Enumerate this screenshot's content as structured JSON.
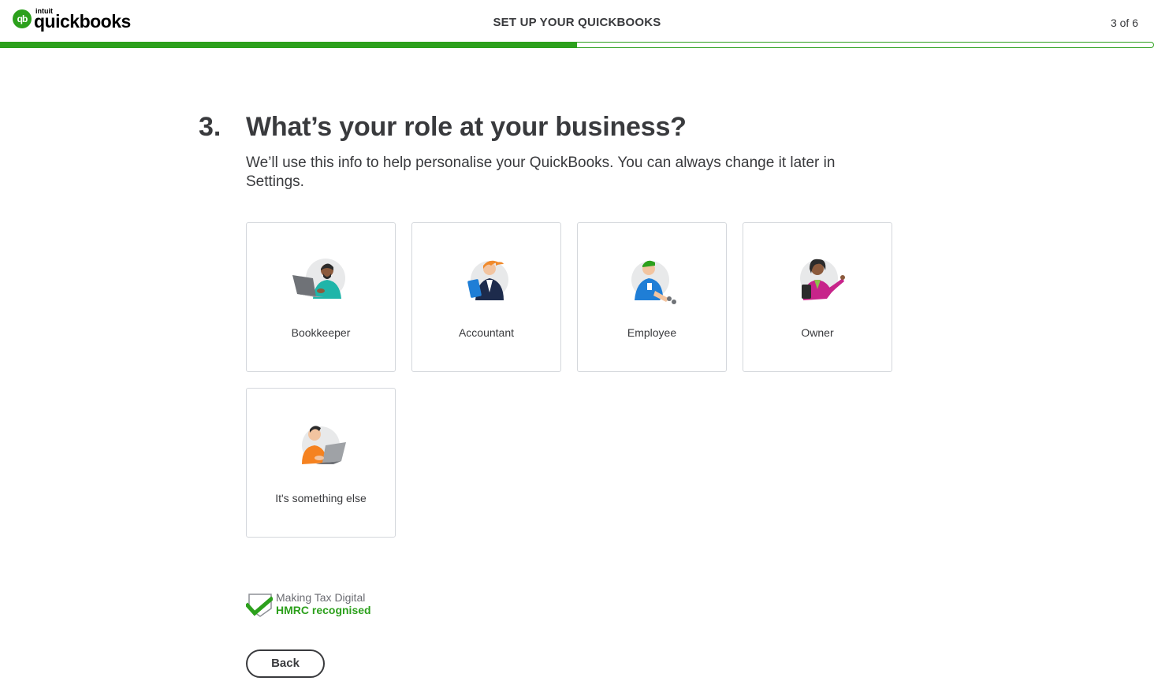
{
  "header": {
    "logo_brand_small": "intuit",
    "logo_brand": "quickbooks",
    "title": "SET UP YOUR QUICKBOOKS",
    "step_counter": "3 of 6"
  },
  "progress": {
    "fraction": 0.5
  },
  "question": {
    "number": "3.",
    "title": "What’s your role at your business?",
    "subtitle": "We’ll use this info to help personalise your QuickBooks. You can always change it later in Settings."
  },
  "roles": [
    {
      "label": "Bookkeeper",
      "icon": "bookkeeper-illustration-icon"
    },
    {
      "label": "Accountant",
      "icon": "accountant-illustration-icon"
    },
    {
      "label": "Employee",
      "icon": "employee-illustration-icon"
    },
    {
      "label": "Owner",
      "icon": "owner-illustration-icon"
    },
    {
      "label": "It's something else",
      "icon": "something-else-illustration-icon"
    }
  ],
  "mtd": {
    "line1": "Making Tax Digital",
    "line2": "HMRC recognised"
  },
  "actions": {
    "back_label": "Back"
  },
  "colors": {
    "brand_green": "#2ca01c",
    "text": "#393a3d",
    "card_border": "#d4d7dc"
  }
}
